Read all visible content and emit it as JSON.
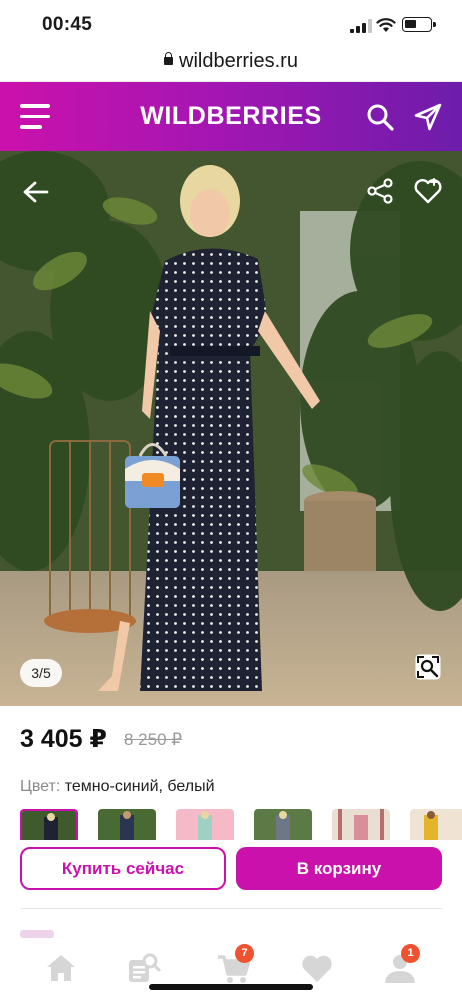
{
  "status_bar": {
    "time": "00:45"
  },
  "browser": {
    "url": "wildberries.ru"
  },
  "header": {
    "logo": "WILDBERRIES",
    "icons": [
      "menu-icon",
      "search-icon",
      "location-arrow-icon"
    ]
  },
  "gallery": {
    "counter": "3/5",
    "icons": [
      "back-arrow-icon",
      "share-icon",
      "heart-icon",
      "zoom-search-icon"
    ],
    "colors": {
      "dress": "#1e2233",
      "dots": "#f0f0f0",
      "bag_blue": "#7ba1d4",
      "bag_orange": "#f08a24"
    }
  },
  "product": {
    "price": "3 405 ₽",
    "old_price": "8 250 ₽",
    "color_label": "Цвет:",
    "color_value": "темно-синий, белый",
    "variants_count": 6
  },
  "actions": {
    "buy_now": "Купить сейчас",
    "add_to_cart": "В корзину"
  },
  "tabbar": {
    "tabs": [
      {
        "name": "home",
        "icon": "home-icon"
      },
      {
        "name": "catalog",
        "icon": "catalog-search-icon"
      },
      {
        "name": "cart",
        "icon": "cart-icon",
        "badge": "7"
      },
      {
        "name": "favorites",
        "icon": "heart-icon"
      },
      {
        "name": "profile",
        "icon": "profile-icon",
        "badge": "1"
      }
    ]
  },
  "theme": {
    "accent": "#cb11ab",
    "header_gradient": [
      "#cb11ab",
      "#6d1cab"
    ],
    "badge": "#f0512f"
  }
}
